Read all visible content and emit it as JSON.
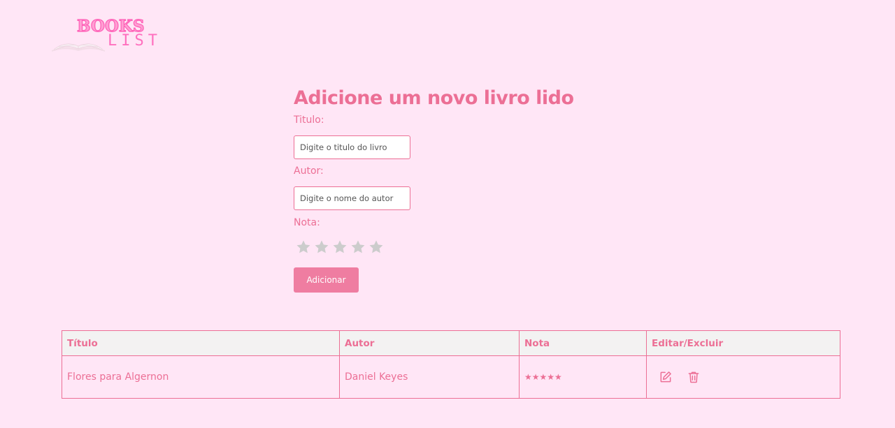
{
  "logo": {
    "word1": "BOOKS",
    "word2": "LIST"
  },
  "form": {
    "heading": "Adicione um novo livro lido",
    "title_label": "Titulo:",
    "title_placeholder": "Digite o titulo do livro",
    "author_label": "Autor:",
    "author_placeholder": "Digite o nome do autor",
    "rating_label": "Nota:",
    "rating_value": 0,
    "rating_max": 5,
    "submit_label": "Adicionar"
  },
  "table": {
    "headers": [
      "Título",
      "Autor",
      "Nota",
      "Editar/Excluir"
    ],
    "rows": [
      {
        "title": "Flores para Algernon",
        "author": "Daniel Keyes",
        "rating": "★★★★★"
      }
    ]
  },
  "colors": {
    "background": "#ffe6f6",
    "accent": "#ec6f95",
    "button": "#ef7da1",
    "star_empty": "#cccccc"
  }
}
